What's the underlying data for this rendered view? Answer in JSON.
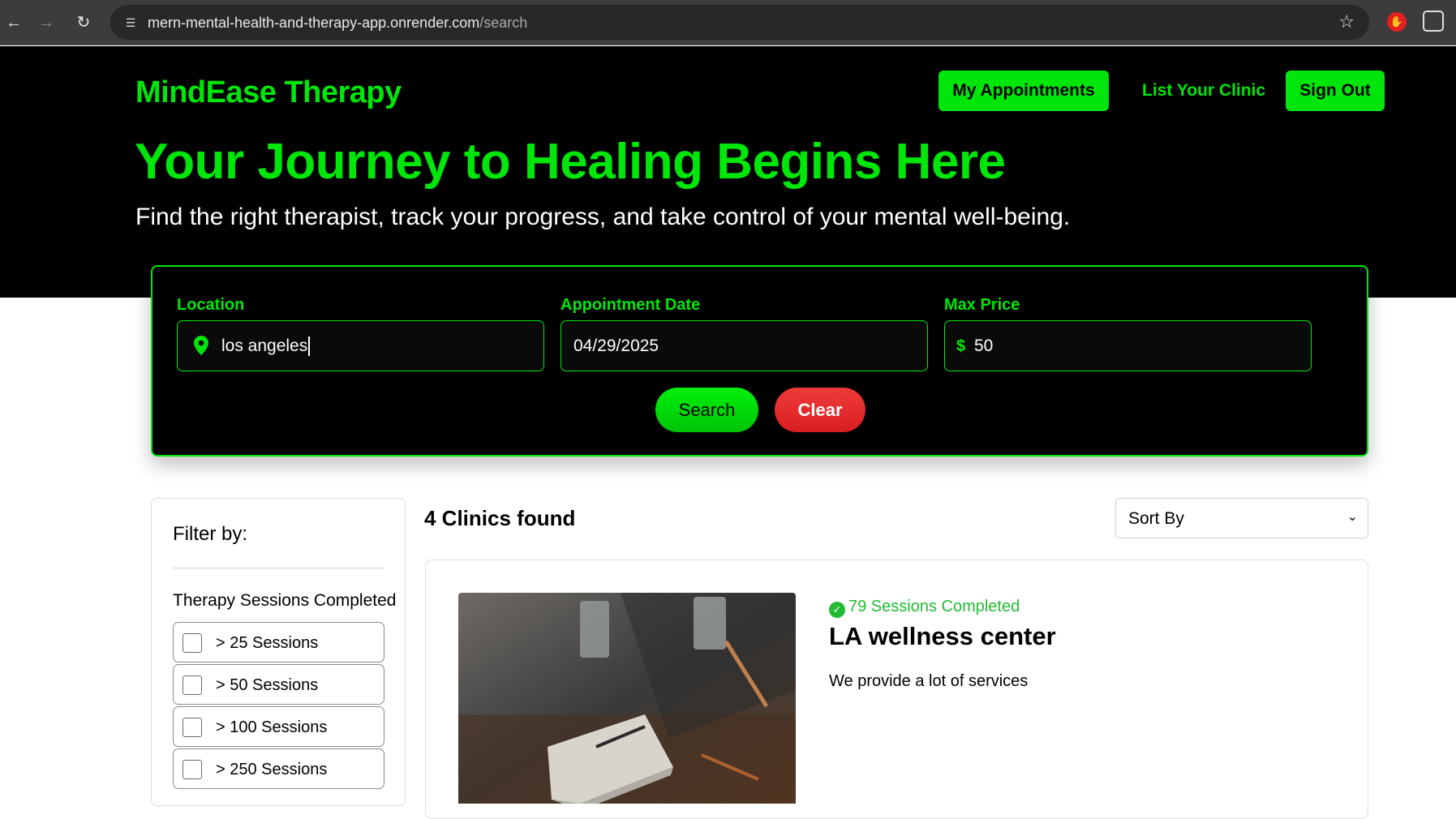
{
  "browser": {
    "url_host": "mern-mental-health-and-therapy-app.onrender.com",
    "url_path": "/search"
  },
  "header": {
    "brand": "MindEase Therapy",
    "nav": {
      "appointments": "My Appointments",
      "list_clinic": "List Your Clinic",
      "sign_out": "Sign Out"
    }
  },
  "hero": {
    "title": "Your Journey to Healing Begins Here",
    "subtitle": "Find the right therapist, track your progress, and take control of your mental well-being."
  },
  "search": {
    "location_label": "Location",
    "location_value": "los angeles",
    "date_label": "Appointment Date",
    "date_value": "04/29/2025",
    "price_label": "Max Price",
    "price_symbol": "$",
    "price_value": "50",
    "search_button": "Search",
    "clear_button": "Clear"
  },
  "filters": {
    "title": "Filter by:",
    "section": "Therapy Sessions Completed",
    "options": [
      "> 25 Sessions",
      "> 50 Sessions",
      "> 100 Sessions",
      "> 250 Sessions"
    ]
  },
  "results": {
    "count_text": "4 Clinics found",
    "sort_label": "Sort By",
    "clinics": [
      {
        "sessions": "79 Sessions Completed",
        "name": "LA wellness center",
        "description": "We provide a lot of services"
      }
    ]
  },
  "colors": {
    "brand_green": "#00e60a",
    "clear_red": "#e02a2a",
    "sessions_green": "#22bb33"
  }
}
